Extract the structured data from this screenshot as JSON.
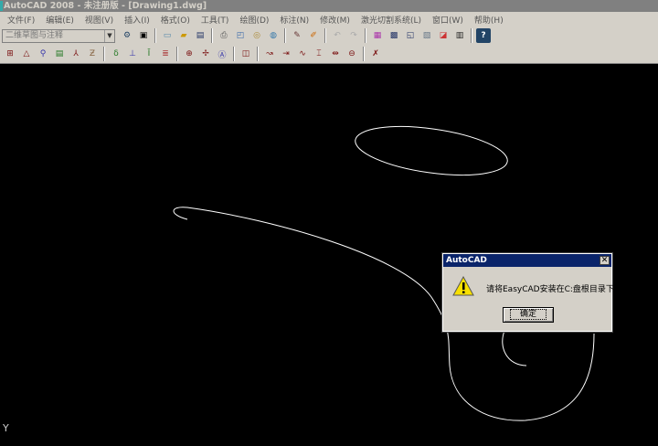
{
  "window": {
    "title": "AutoCAD 2008 - 未注册版 - [Drawing1.dwg]"
  },
  "menu": [
    "文件(F)",
    "编辑(E)",
    "视图(V)",
    "插入(I)",
    "格式(O)",
    "工具(T)",
    "绘图(D)",
    "标注(N)",
    "修改(M)",
    "激光切割系统(L)",
    "窗口(W)",
    "帮助(H)"
  ],
  "toolbar": {
    "workspace": "二维草图与注释"
  },
  "axis": {
    "y": "Y"
  },
  "dialog": {
    "title": "AutoCAD",
    "message": "请将EasyCAD安装在C:盘根目录下!",
    "ok_label": "确定",
    "icon": "warning-icon"
  },
  "colors": {
    "dialog_title": "#0a246a",
    "chrome": "#d4d0c8",
    "canvas": "#000000"
  }
}
